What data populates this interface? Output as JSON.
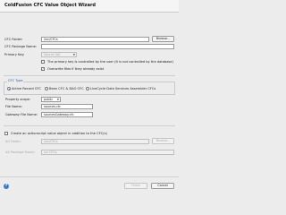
{
  "window": {
    "title": "ColdFusion CFC Value Object Wizard"
  },
  "form": {
    "cfc_folder_label": "CFC Folder:",
    "cfc_folder_value": "/src/CFCs",
    "browse_label": "Browse...",
    "cfc_package_label": "CFC Package Name:",
    "cfc_package_value": "",
    "primary_key_label": "Primary Key:",
    "primary_key_value": "Source (id)",
    "primary_key_db_label": "The primary key is controlled by the user (it is not controlled by the database)",
    "overwrite_label": "Overwrite files if they already exist",
    "overwrite_checked": "✓",
    "cfc_type_legend": "CFC Type",
    "radio_active_record": "Active Record CFC",
    "radio_bean": "Bean CFC & DAO CFC",
    "radio_lcds": "LiveCycle Data Services Assembler CFCs",
    "property_scope_label": "Property scope:",
    "property_scope_value": "public",
    "file_name_label": "File Name:",
    "file_name_value": "sources.cfc",
    "gateway_label": "Gateway File Name:",
    "gateway_value": "sourcesGateway.cfc",
    "create_as_label": "Create an actionscript value object in addition to the CFC(s)",
    "as_folder_label": "AS Folder:",
    "as_folder_value": "/src/CFCs",
    "as_browse_label": "Browse...",
    "as_package_label": "AS Package Name:",
    "as_package_value": "src.CFCs"
  },
  "buttons": {
    "help": "?",
    "finish": "Finish",
    "cancel": "Cancel"
  }
}
